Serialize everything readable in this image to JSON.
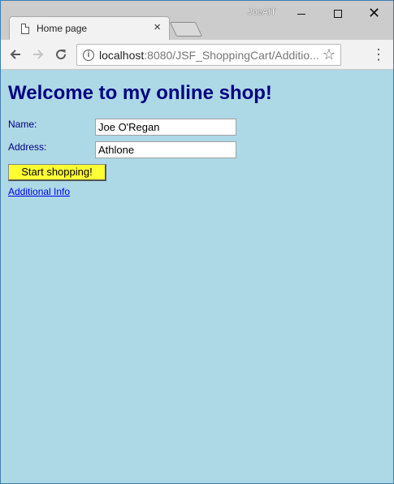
{
  "browser": {
    "tab_title": "Home page",
    "tab_close": "×",
    "profile_name": "JoeAIT",
    "url_host": "localhost",
    "url_rest": ":8080/JSF_ShoppingCart/Additio...",
    "icons": {
      "tab": "document-icon",
      "back": "arrow-left-icon",
      "forward": "arrow-right-icon",
      "reload": "reload-icon",
      "info": "info-icon",
      "bookmark": "star-icon",
      "menu": "kebab-menu-icon"
    }
  },
  "page": {
    "heading": "Welcome to my online shop!",
    "form": {
      "name_label": "Name:",
      "name_value": "Joe O'Regan",
      "address_label": "Address:",
      "address_value": "Athlone",
      "submit_label": "Start shopping!"
    },
    "link_label": "Additional Info"
  },
  "colors": {
    "page_background": "#add8e6",
    "heading": "#000080",
    "button_background": "#ffff33",
    "link": "#0000ee"
  }
}
